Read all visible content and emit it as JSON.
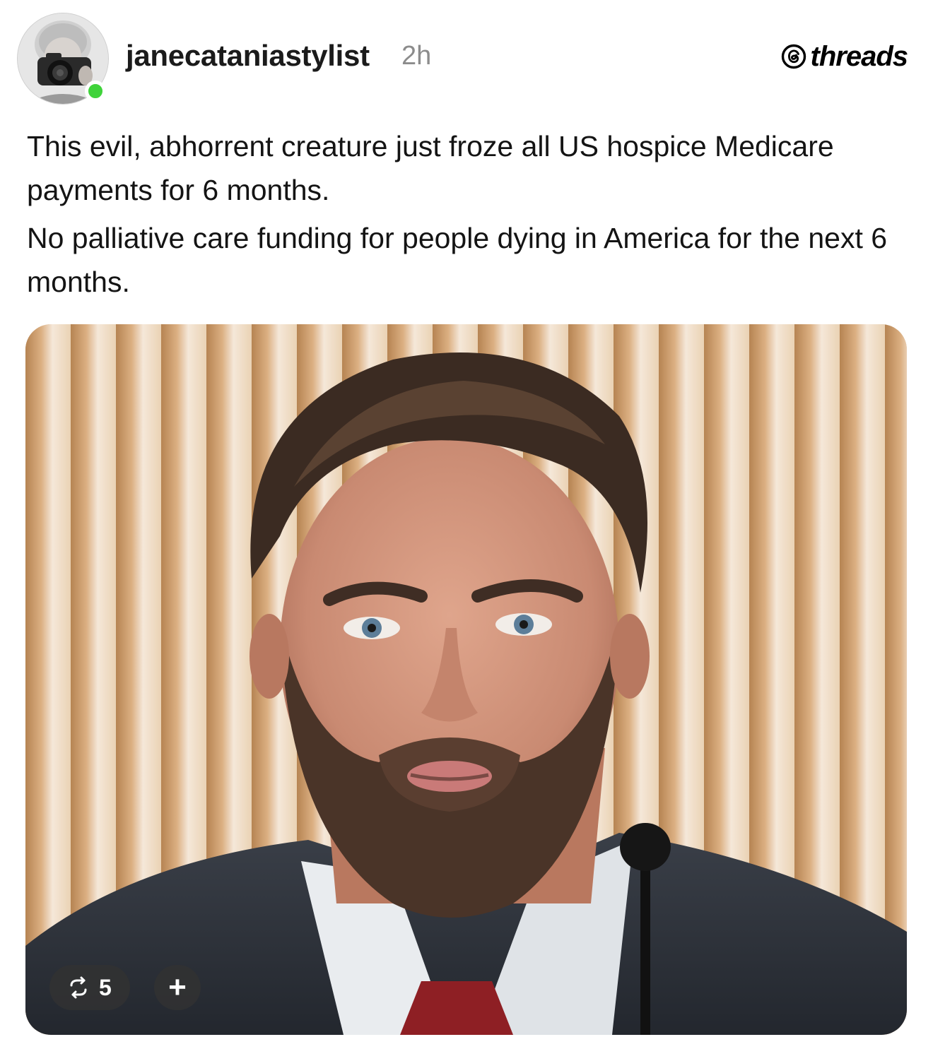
{
  "post": {
    "author": {
      "username": "janecataniastylist",
      "time_ago": "2h",
      "avatar_icon": "avatar-photographer-icon",
      "online_status_color": "#3fd33a"
    },
    "platform": {
      "name": "threads",
      "logo_icon": "threads-logo-icon"
    },
    "text": {
      "paragraph_1": "This evil, abhorrent creature just froze all US hospice Medicare payments for 6 months.",
      "paragraph_2": "No palliative care funding for people dying in America for the next 6 months."
    },
    "media": {
      "type": "photo",
      "repost_icon": "repost-icon",
      "repost_count": "5",
      "add_label": "+"
    }
  }
}
